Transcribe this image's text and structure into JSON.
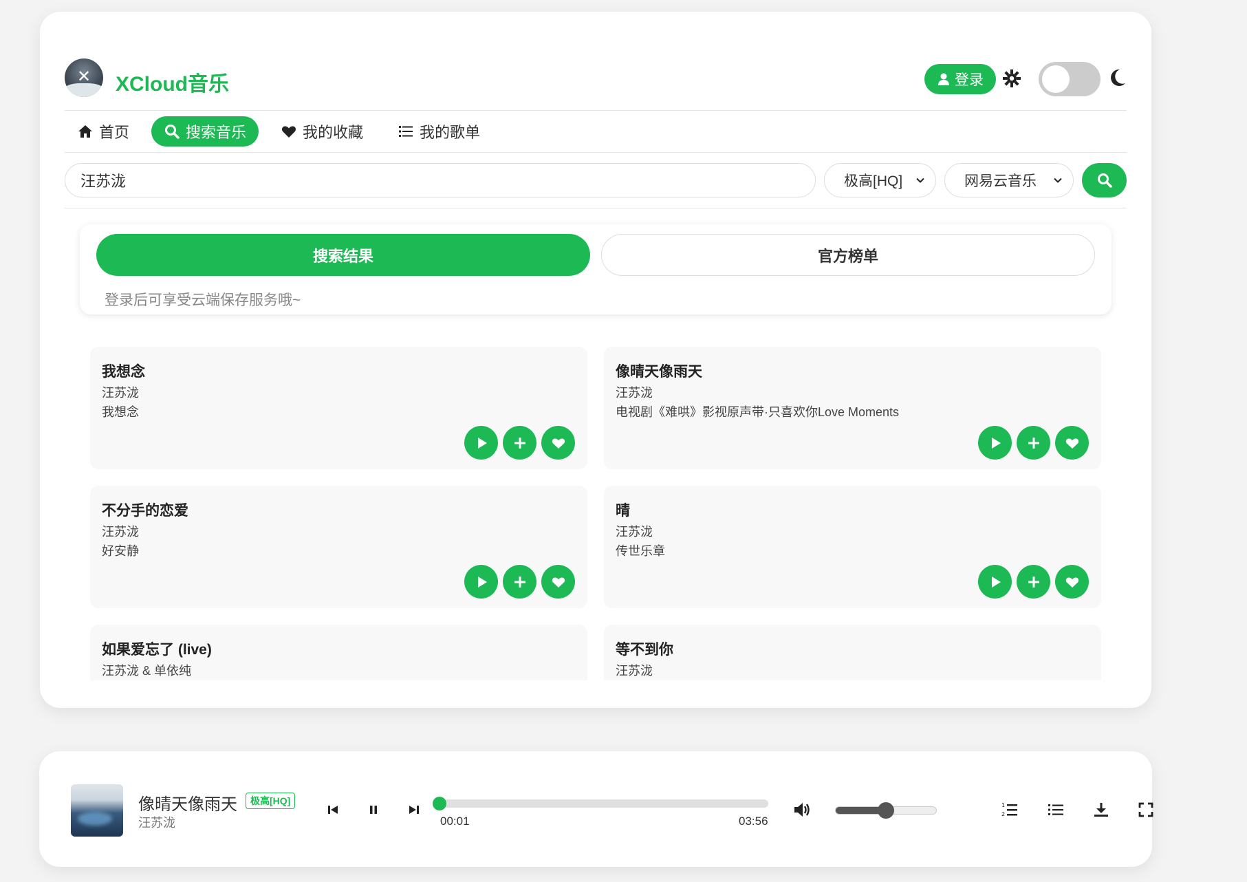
{
  "app": {
    "name": "XCloud音乐"
  },
  "header": {
    "login_label": "登录"
  },
  "nav": [
    {
      "label": "首页",
      "icon": "home-icon"
    },
    {
      "label": "搜索音乐",
      "icon": "search-icon"
    },
    {
      "label": "我的收藏",
      "icon": "heart-icon"
    },
    {
      "label": "我的歌单",
      "icon": "list-icon"
    }
  ],
  "search": {
    "value": "汪苏泷",
    "quality": "极高[HQ]",
    "source": "网易云音乐"
  },
  "tabs": {
    "results": "搜索结果",
    "charts": "官方榜单"
  },
  "tip": "登录后可享受云端保存服务哦~",
  "songs": [
    {
      "title": "我想念",
      "artist": "汪苏泷",
      "album": "我想念"
    },
    {
      "title": "像晴天像雨天",
      "artist": "汪苏泷",
      "album": "电视剧《难哄》影视原声带·只喜欢你Love Moments"
    },
    {
      "title": "不分手的恋爱",
      "artist": "汪苏泷",
      "album": "好安静"
    },
    {
      "title": "晴",
      "artist": "汪苏泷",
      "album": "传世乐章"
    },
    {
      "title": "如果爱忘了 (live)",
      "artist": "汪苏泷 & 单依纯",
      "album": ""
    },
    {
      "title": "等不到你",
      "artist": "汪苏泷",
      "album": ""
    }
  ],
  "player": {
    "title": "像晴天像雨天",
    "badge": "极高[HQ]",
    "artist": "汪苏泷",
    "current_time": "00:01",
    "total_time": "03:56",
    "progress_fraction": 0.004,
    "volume_fraction": 0.5
  },
  "colors": {
    "accent": "#1db954"
  }
}
